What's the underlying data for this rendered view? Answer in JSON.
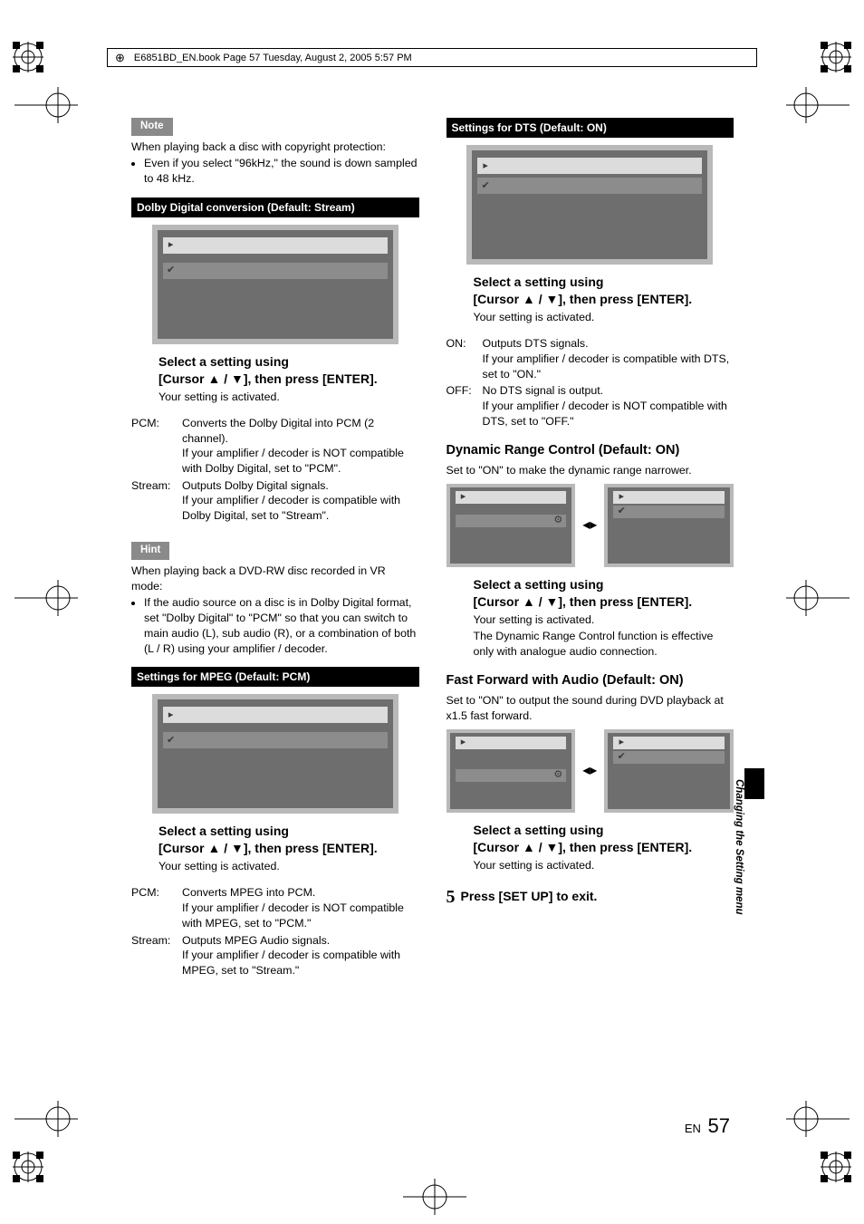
{
  "running_head": "E6851BD_EN.book  Page 57  Tuesday, August 2, 2005  5:57 PM",
  "note_label": "Note",
  "hint_label": "Hint",
  "note_body": {
    "line1": "When playing back a disc with copyright protection:",
    "bullet": "Even if you select \"96kHz,\" the sound is down sampled to 48 kHz."
  },
  "blackbars": {
    "dolby": "Dolby Digital conversion (Default: Stream)",
    "mpeg": "Settings for MPEG (Default: PCM)",
    "dts": "Settings for DTS (Default: ON)"
  },
  "instruct": {
    "head_l1": "Select a setting using",
    "head_l2_pre": "[Cursor ",
    "head_l2_mid": " / ",
    "head_l2_post": "], then press [ENTER].",
    "tri_up": "▲",
    "tri_down": "▼",
    "sub": "Your setting is activated."
  },
  "dolby_def": {
    "pcm_dt": "PCM:",
    "pcm_dd1": "Converts the Dolby Digital into PCM (2 channel).",
    "pcm_dd2": "If your amplifier / decoder is NOT compatible with Dolby Digital, set to \"PCM\".",
    "stream_dt": "Stream:",
    "stream_dd1": "Outputs Dolby Digital signals.",
    "stream_dd2": "If your amplifier / decoder is compatible with Dolby Digital, set to \"Stream\"."
  },
  "hint_body": {
    "line1": "When playing back a DVD-RW disc recorded in VR mode:",
    "bullet": "If the audio source on a disc is in Dolby Digital format, set \"Dolby Digital\" to \"PCM\" so that you can switch to main audio (L), sub audio (R), or a combination of both (L / R) using your amplifier / decoder."
  },
  "mpeg_def": {
    "pcm_dt": "PCM:",
    "pcm_dd1": "Converts MPEG into PCM.",
    "pcm_dd2": "If your amplifier / decoder is NOT compatible with MPEG, set to \"PCM.\"",
    "stream_dt": "Stream:",
    "stream_dd1": "Outputs MPEG Audio signals.",
    "stream_dd2": "If your amplifier / decoder is compatible with MPEG, set to \"Stream.\""
  },
  "dts_def": {
    "on_dt": "ON:",
    "on_dd1": "Outputs DTS signals.",
    "on_dd2": "If your amplifier / decoder is compatible with DTS, set to \"ON.\"",
    "off_dt": "OFF:",
    "off_dd1": "No DTS signal is output.",
    "off_dd2": "If your amplifier / decoder is NOT compatible with DTS, set to \"OFF.\""
  },
  "drc": {
    "heading": "Dynamic Range Control (Default: ON)",
    "sub": "Set to \"ON\" to make the dynamic range narrower.",
    "note": "The Dynamic Range Control function is effective only with analogue audio connection."
  },
  "ffa": {
    "heading": "Fast Forward with Audio (Default: ON)",
    "sub": "Set to \"ON\" to output the sound during DVD playback at x1.5 fast forward."
  },
  "step5": "Press [SET UP] to exit.",
  "step5_num": "5",
  "footer_lang": "EN",
  "footer_page": "57",
  "vtab": "Changing the Setting menu",
  "icons": {
    "play": "▸",
    "check": "✔",
    "gear": "⚙",
    "lr": "◂▸"
  }
}
